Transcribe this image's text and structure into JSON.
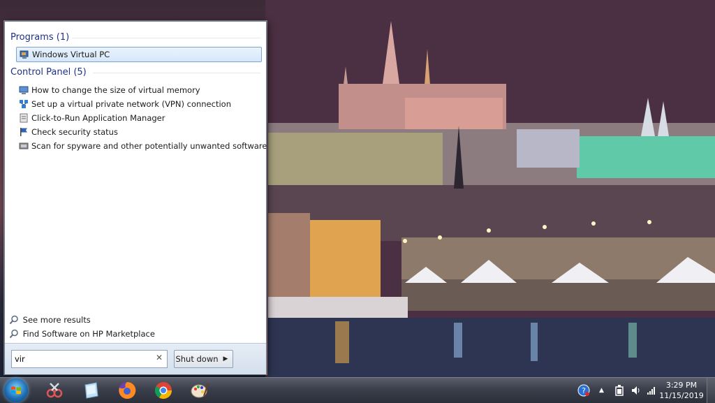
{
  "start_menu": {
    "programs_header": "Programs (1)",
    "programs": [
      {
        "label": "Windows Virtual PC",
        "icon": "virtual-pc-icon",
        "selected": true
      }
    ],
    "control_panel_header": "Control Panel (5)",
    "control_panel_items": [
      {
        "label": "How to change the size of virtual memory",
        "icon": "system-icon"
      },
      {
        "label": "Set up a virtual private network (VPN) connection",
        "icon": "network-icon"
      },
      {
        "label": "Click-to-Run Application Manager",
        "icon": "app-manager-icon"
      },
      {
        "label": "Check security status",
        "icon": "action-center-flag-icon"
      },
      {
        "label": "Scan for spyware and other potentially unwanted software",
        "icon": "defender-icon"
      }
    ],
    "see_more": "See more results",
    "find_software": "Find Software on HP Marketplace",
    "search_value": "vir",
    "shutdown_label": "Shut down"
  },
  "taskbar": {
    "apps": [
      "snipping-tool-icon",
      "sticky-notes-icon",
      "firefox-icon",
      "chrome-icon",
      "paint-icon"
    ],
    "tray_icons": [
      "help-icon",
      "show-hidden-icons-icon",
      "power-icon",
      "volume-icon",
      "network-signal-icon"
    ],
    "time": "3:29 PM",
    "date": "11/15/2019"
  },
  "colors": {
    "accent_header": "#1e3287",
    "selection_border": "#7da2ce",
    "taskbar": "#2b2f3a"
  }
}
